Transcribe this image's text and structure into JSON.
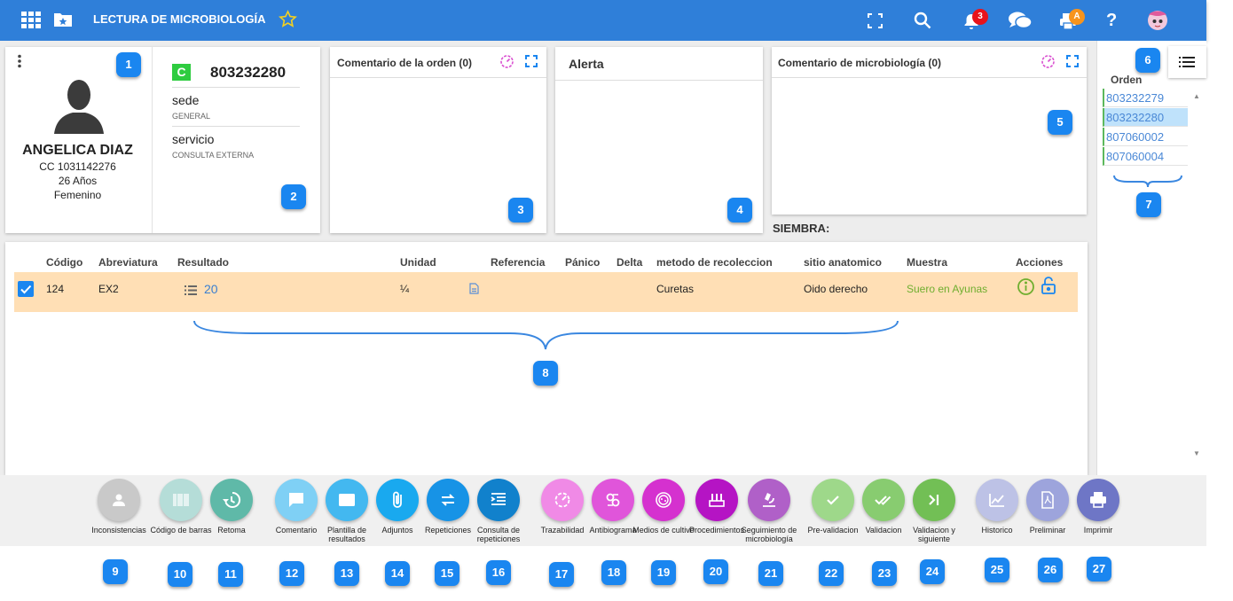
{
  "header": {
    "title": "LECTURA DE MICROBIOLOGÍA",
    "notifications_count": "3",
    "print_badge": "A"
  },
  "patient": {
    "name": "ANGELICA DIAZ",
    "doc": "CC 1031142276",
    "age": "26 Años",
    "gender": "Femenino"
  },
  "order": {
    "badge": "C",
    "number": "803232280",
    "sede_label": "sede",
    "sede_value": "GENERAL",
    "servicio_label": "servicio",
    "servicio_value": "CONSULTA EXTERNA"
  },
  "panels": {
    "order_comment": "Comentario de la orden (0)",
    "alert": "Alerta",
    "micro_comment": "Comentario de microbiología (0)",
    "siembra": "SIEMBRA:"
  },
  "table": {
    "headers": [
      "Código",
      "Abreviatura",
      "Resultado",
      "Unidad",
      "Referencia",
      "Pánico",
      "Delta",
      "metodo de recoleccion",
      "sitio anatomico",
      "Muestra",
      "Acciones"
    ],
    "row": {
      "codigo": "124",
      "abreviatura": "EX2",
      "resultado": "20",
      "unidad": "¼",
      "metodo": "Curetas",
      "sitio": "Oido derecho",
      "muestra": "Suero en Ayunas"
    }
  },
  "sidebar": {
    "header": "Orden",
    "orders": [
      "803232279",
      "803232280",
      "807060002",
      "807060004"
    ],
    "selected_index": 1
  },
  "markers": [
    "1",
    "2",
    "3",
    "4",
    "5",
    "6",
    "7",
    "8",
    "9",
    "10",
    "11",
    "12",
    "13",
    "14",
    "15",
    "16",
    "17",
    "18",
    "19",
    "20",
    "21",
    "22",
    "23",
    "24",
    "25",
    "26",
    "27"
  ],
  "actions": [
    {
      "label": "Inconsistencias",
      "color": "#c9c9c9",
      "icon": "person-icon"
    },
    {
      "label": "Código de barras",
      "color": "#b5ddd8",
      "icon": "barcode-icon"
    },
    {
      "label": "Retoma",
      "color": "#5fb9a8",
      "icon": "history-icon"
    },
    {
      "label": "Comentario",
      "color": "#7fd0f5",
      "icon": "comment-icon"
    },
    {
      "label": "Plantilla de resultados",
      "color": "#43b8f0",
      "icon": "template-icon"
    },
    {
      "label": "Adjuntos",
      "color": "#19a9ef",
      "icon": "attach-icon"
    },
    {
      "label": "Repeticiones",
      "color": "#1793e6",
      "icon": "repeat-icon"
    },
    {
      "label": "Consulta de repeticiones",
      "color": "#1181cc",
      "icon": "list-icon"
    },
    {
      "label": "Trazabilidad",
      "color": "#f08ae6",
      "icon": "trace-icon"
    },
    {
      "label": "Antibiograma",
      "color": "#e055da",
      "icon": "antibiogram-icon"
    },
    {
      "label": "Medios de cultivo",
      "color": "#d531cf",
      "icon": "petri-icon"
    },
    {
      "label": "Procedimientos",
      "color": "#b514c4",
      "icon": "procedure-icon"
    },
    {
      "label": "Seguimiento de microbiología",
      "color": "#b060c8",
      "icon": "microscope-icon"
    },
    {
      "label": "Pre-validacion",
      "color": "#9ed88a",
      "icon": "check-icon"
    },
    {
      "label": "Validacion",
      "color": "#88cc70",
      "icon": "double-check-icon"
    },
    {
      "label": "Validacion y siguiente",
      "color": "#72bf55",
      "icon": "next-icon"
    },
    {
      "label": "Historico",
      "color": "#bdc2e6",
      "icon": "chart-icon"
    },
    {
      "label": "Preliminar",
      "color": "#9da4dc",
      "icon": "pdf-icon"
    },
    {
      "label": "Imprimir",
      "color": "#6e76c6",
      "icon": "print-icon"
    }
  ]
}
